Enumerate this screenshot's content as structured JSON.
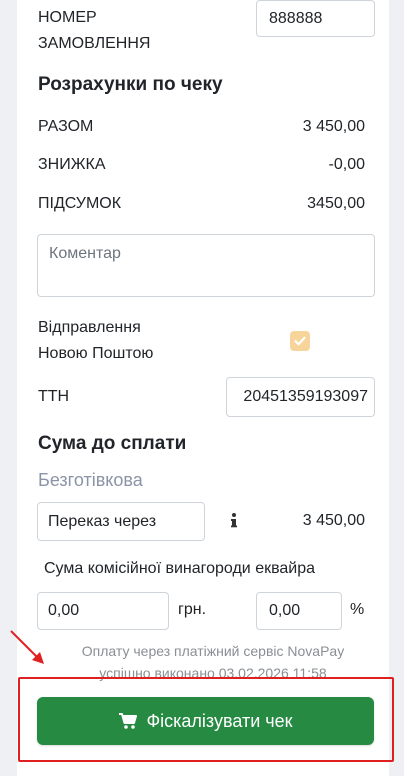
{
  "order": {
    "label_line1": "НОМЕР",
    "label_line2": "ЗАМОВЛЕННЯ",
    "value": "888888"
  },
  "receipt": {
    "heading": "Розрахунки по чеку",
    "rows": [
      {
        "label": "РАЗОМ",
        "value": "3 450,00"
      },
      {
        "label": "ЗНИЖКА",
        "value": "-0,00"
      },
      {
        "label": "ПІДСУМОК",
        "value": "3450,00"
      }
    ]
  },
  "comment": {
    "placeholder": "Коментар"
  },
  "nova_poshta": {
    "label_line1": "Відправлення",
    "label_line2": "Новою Поштою",
    "checked": true
  },
  "ttn": {
    "label": "ТТН",
    "value": "20451359193097"
  },
  "payment": {
    "heading": "Сума до сплати",
    "method": "Безготівкова",
    "transfer_select": "Переказ через",
    "amount": "3 450,00"
  },
  "commission": {
    "label": "Сума комісійної винагороди еквайра",
    "uah_value": "0,00",
    "uah_unit": "грн.",
    "pct_value": "0,00",
    "pct_unit": "%"
  },
  "notice": {
    "line1": "Оплату через платіжний сервіс NovaPay",
    "line2": "успішно виконано 03.02.2026 11:58"
  },
  "fiscalize_button": {
    "label": "Фіскалізувати чек"
  },
  "colors": {
    "primary_green": "#268a43",
    "checkbox_bg": "#f6d49a",
    "annotation_red": "#e02020"
  }
}
